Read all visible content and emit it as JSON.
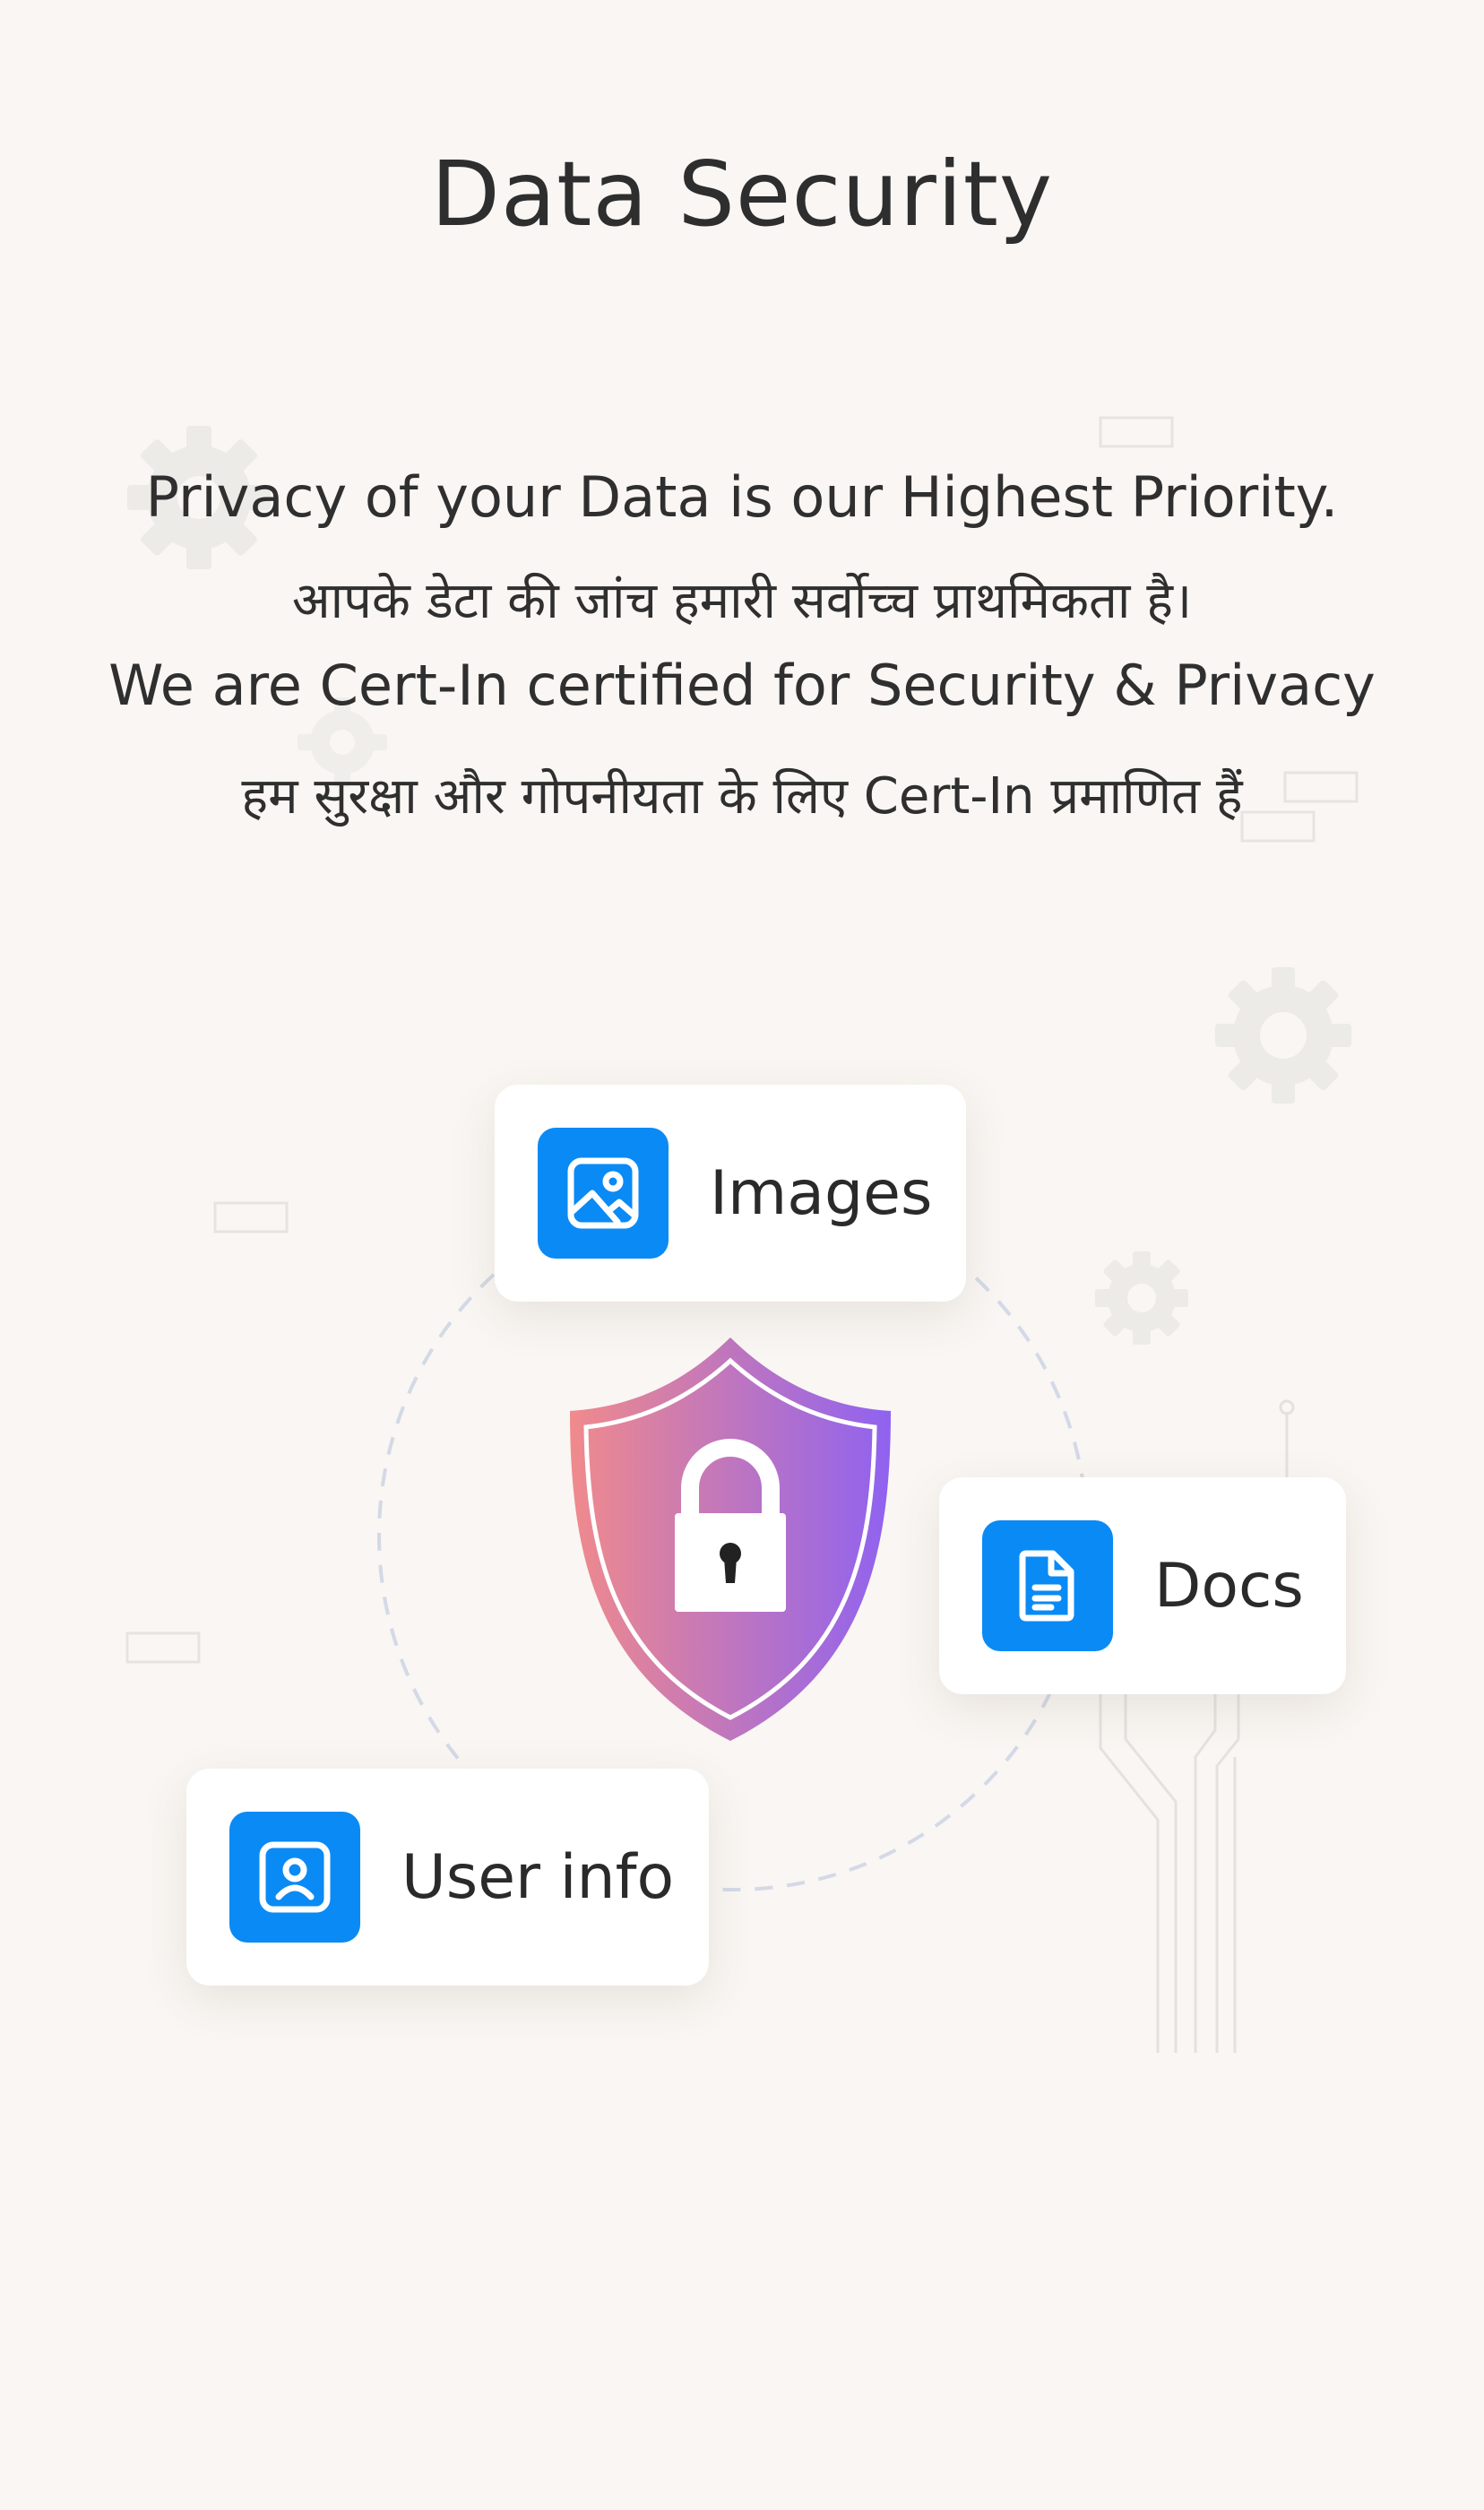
{
  "header": {
    "title": "Data Security"
  },
  "content": {
    "line1": "Privacy of your Data is our Highest Priority.",
    "line2": "आपके डेटा की जांच हमारी सर्वोच्च प्राथमिकता है।",
    "line3": "We are Cert-In certified for Security & Privacy",
    "line4": "हम सुरक्षा और गोपनीयता के लिए Cert-In प्रमाणित हैं"
  },
  "cards": [
    {
      "label": "Images",
      "icon": "image-icon"
    },
    {
      "label": "Docs",
      "icon": "document-icon"
    },
    {
      "label": "User info",
      "icon": "user-profile-icon"
    }
  ],
  "colors": {
    "background": "#f9f6f3",
    "accent": "#0a8af5",
    "shield_gradient_start": "#f08a8c",
    "shield_gradient_end": "#8f62f0"
  }
}
